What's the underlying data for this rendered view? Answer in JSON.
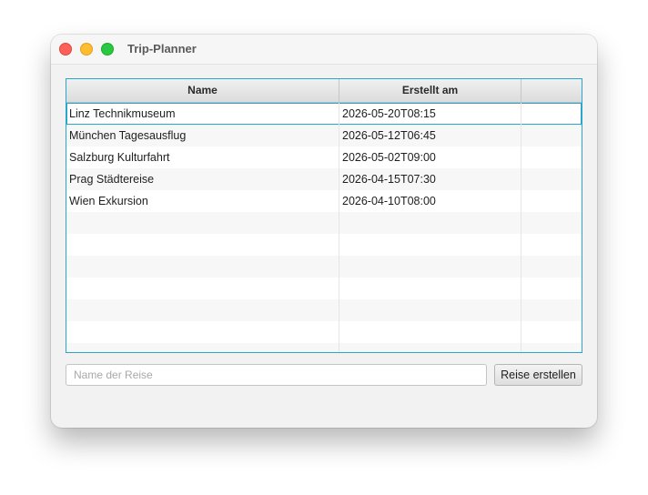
{
  "window": {
    "title": "Trip-Planner"
  },
  "table": {
    "columns": [
      "Name",
      "Erstellt am",
      ""
    ],
    "rows": [
      {
        "name": "Linz Technikmuseum",
        "created": "2026-05-20T08:15"
      },
      {
        "name": "München Tagesausflug",
        "created": "2026-05-12T06:45"
      },
      {
        "name": "Salzburg Kulturfahrt",
        "created": "2026-05-02T09:00"
      },
      {
        "name": "Prag Städtereise",
        "created": "2026-04-15T07:30"
      },
      {
        "name": "Wien Exkursion",
        "created": "2026-04-10T08:00"
      }
    ],
    "selected_row_index": 0
  },
  "form": {
    "name_placeholder": "Name der Reise",
    "name_value": "",
    "create_label": "Reise erstellen"
  },
  "colors": {
    "focus_accent": "#2aa5cc",
    "close": "#fe5f57",
    "minimize": "#febc2e",
    "maximize": "#28c840"
  }
}
